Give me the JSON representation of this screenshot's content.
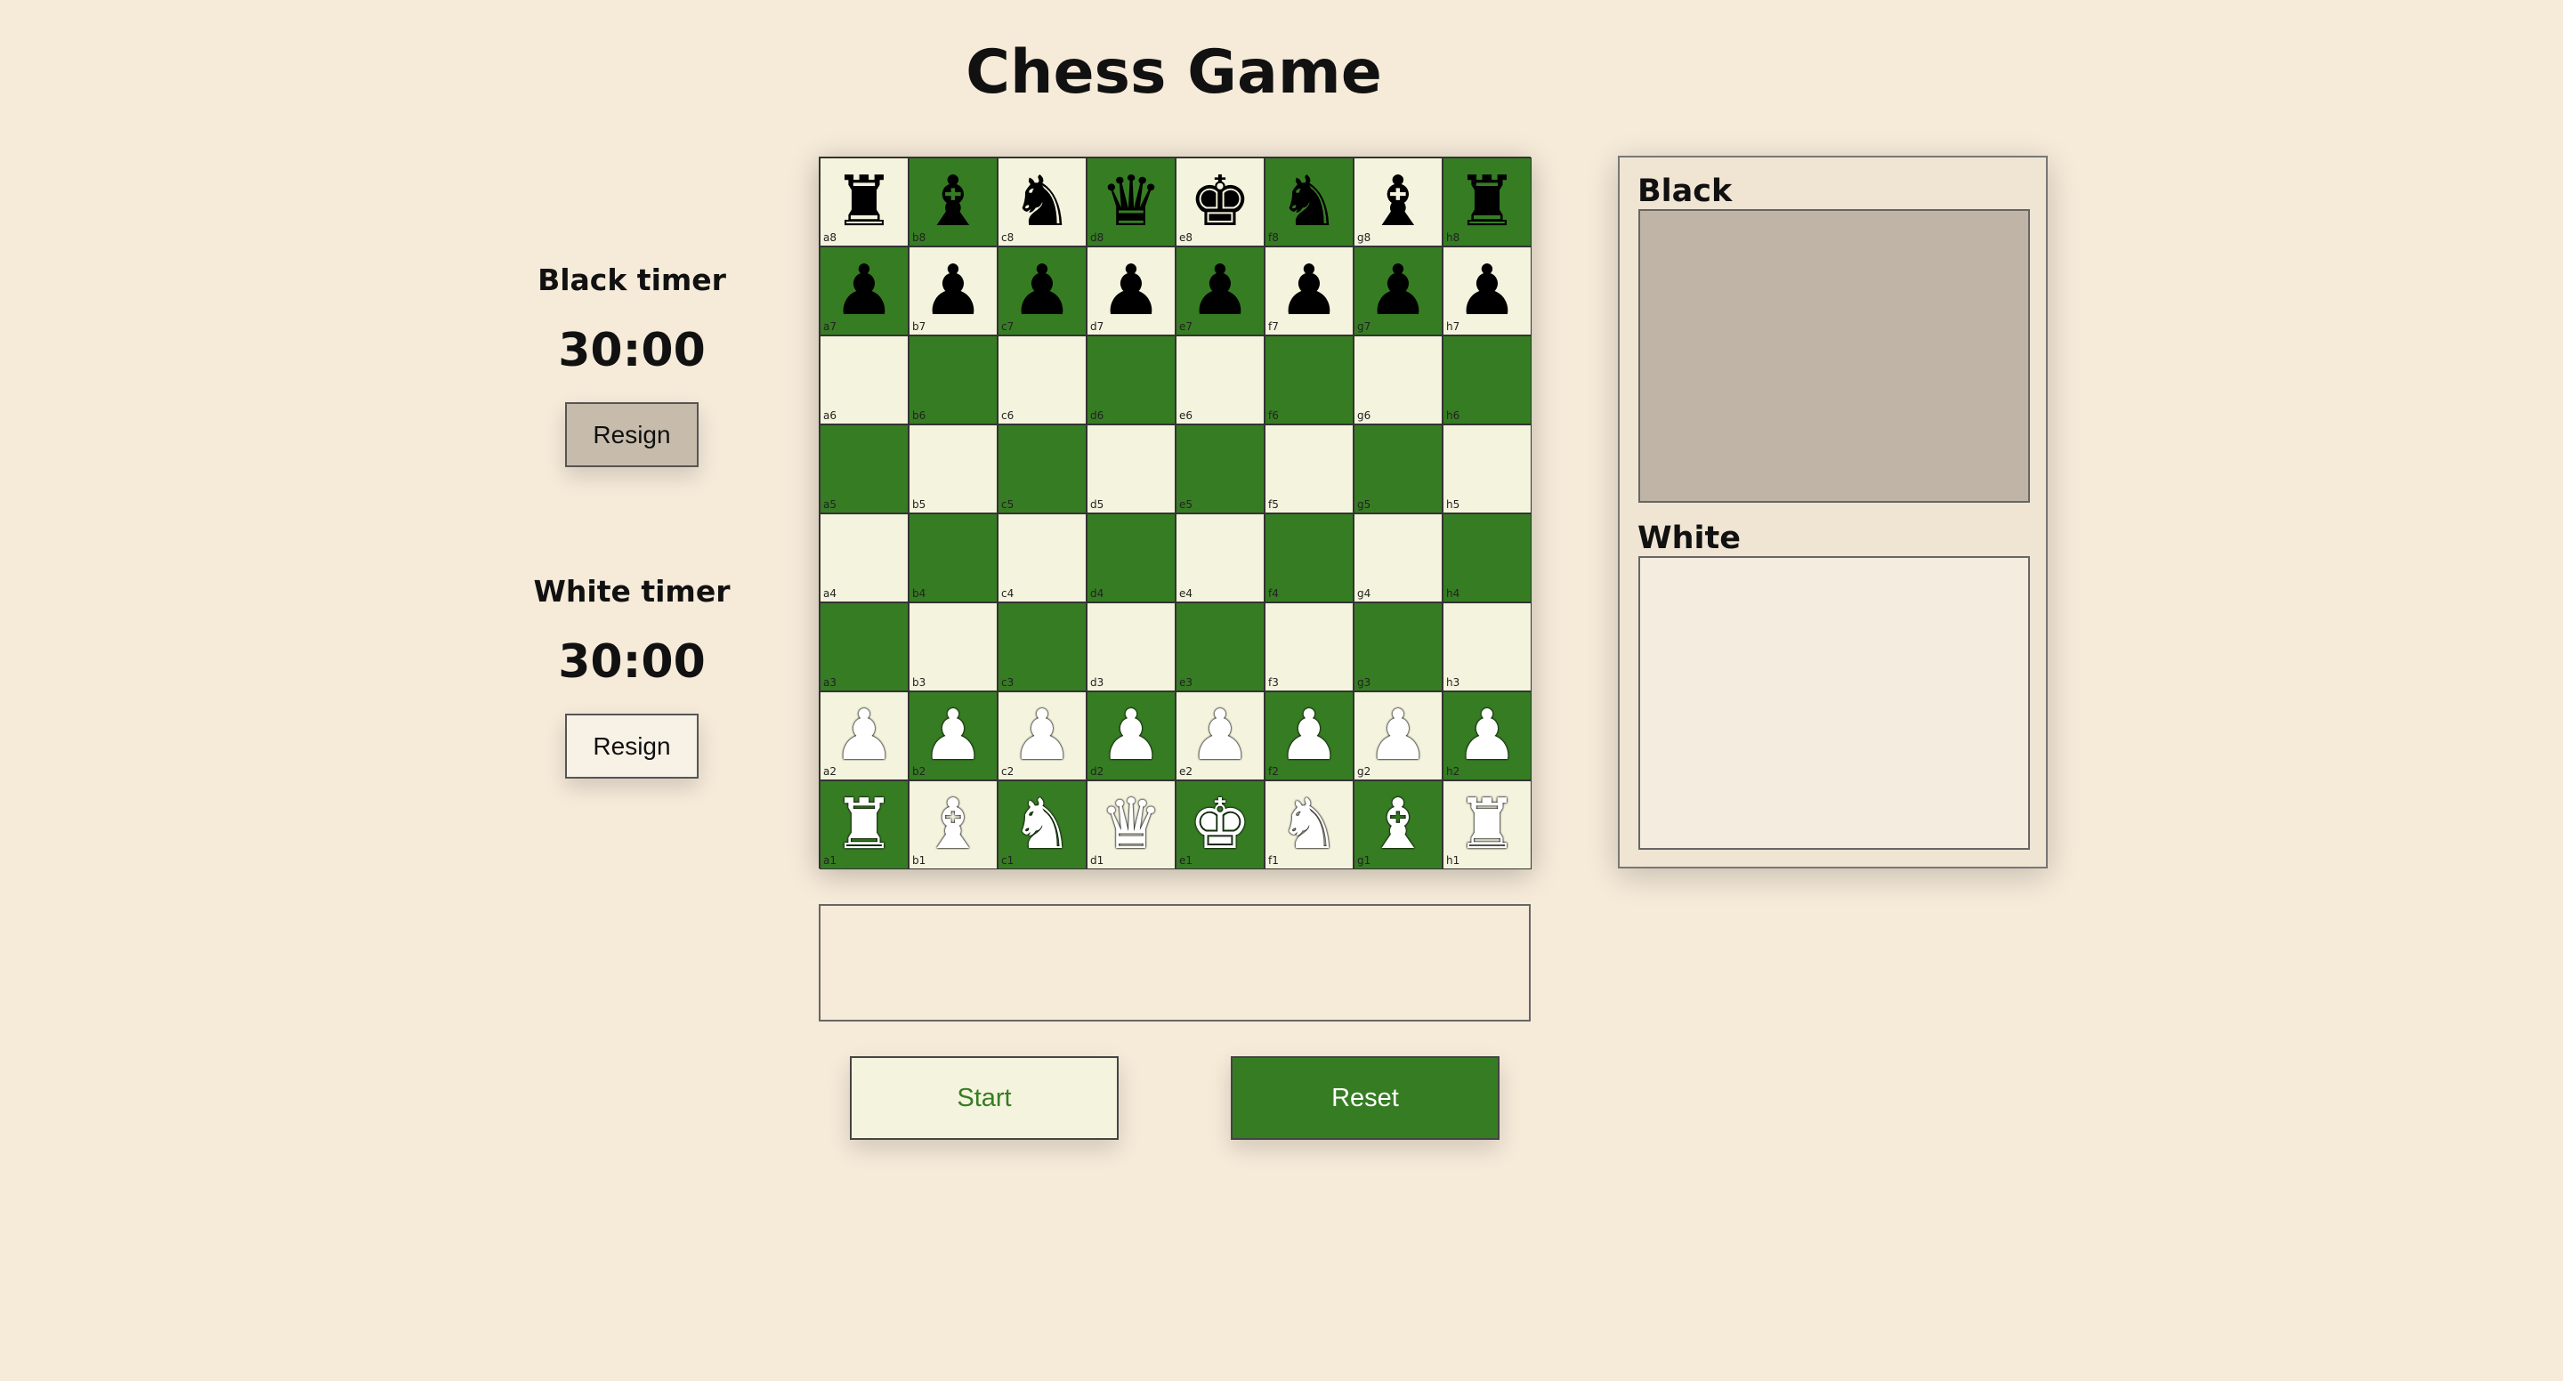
{
  "title": "Chess Game",
  "timers": {
    "black": {
      "label": "Black timer",
      "value": "30:00",
      "resign_label": "Resign"
    },
    "white": {
      "label": "White timer",
      "value": "30:00",
      "resign_label": "Resign"
    }
  },
  "controls": {
    "start_label": "Start",
    "reset_label": "Reset"
  },
  "message": "",
  "captured": {
    "black_label": "Black",
    "white_label": "White",
    "black_pieces": [],
    "white_pieces": []
  },
  "colors": {
    "background": "#f6ead9",
    "light_square": "#f4f3dd",
    "dark_square": "#367c23"
  },
  "board": {
    "files": [
      "a",
      "b",
      "c",
      "d",
      "e",
      "f",
      "g",
      "h"
    ],
    "ranks": [
      8,
      7,
      6,
      5,
      4,
      3,
      2,
      1
    ],
    "position": {
      "a8": "black-rook",
      "b8": "black-bishop",
      "c8": "black-knight",
      "d8": "black-queen",
      "e8": "black-king",
      "f8": "black-knight",
      "g8": "black-bishop",
      "h8": "black-rook",
      "a7": "black-pawn",
      "b7": "black-pawn",
      "c7": "black-pawn",
      "d7": "black-pawn",
      "e7": "black-pawn",
      "f7": "black-pawn",
      "g7": "black-pawn",
      "h7": "black-pawn",
      "a2": "white-pawn",
      "b2": "white-pawn",
      "c2": "white-pawn",
      "d2": "white-pawn",
      "e2": "white-pawn",
      "f2": "white-pawn",
      "g2": "white-pawn",
      "h2": "white-pawn",
      "a1": "white-rook",
      "b1": "white-bishop",
      "c1": "white-knight",
      "d1": "white-queen",
      "e1": "white-king",
      "f1": "white-knight",
      "g1": "white-bishop",
      "h1": "white-rook"
    }
  }
}
